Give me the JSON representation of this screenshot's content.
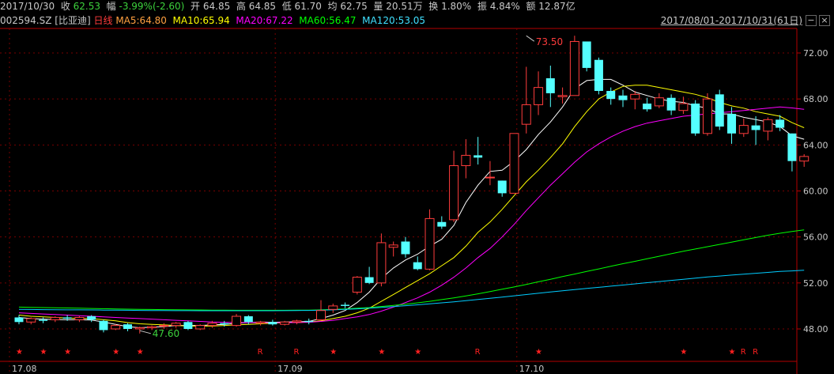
{
  "header": {
    "date": "2017/10/30",
    "close_label": "收",
    "close": "62.53",
    "change_label": "幅",
    "change": "-3.99%(-2.60)",
    "open_label": "开",
    "open": "64.85",
    "high_label": "高",
    "high": "64.85",
    "low_label": "低",
    "low": "61.70",
    "avg_label": "均",
    "avg": "62.75",
    "vol_label": "量",
    "vol": "20.51万",
    "turn_label": "换",
    "turn": "1.80%",
    "amp_label": "振",
    "amp": "4.84%",
    "amt_label": "额",
    "amt": "12.87亿"
  },
  "legend": {
    "code": "002594.SZ [比亚迪]",
    "period": "日线",
    "ma5": "MA5:64.80",
    "ma10": "MA10:65.94",
    "ma20": "MA20:67.22",
    "ma60": "MA60:56.47",
    "ma120": "MA120:53.05",
    "range": "2017/08/01-2017/10/31(61日)"
  },
  "controls": {
    "min": "−",
    "close": "×"
  },
  "colors": {
    "up": "#ff3c3c",
    "down": "#54ffff",
    "ma5": "#ffffff",
    "ma10": "#ffff00",
    "ma20": "#ff00ff",
    "ma60": "#00ff00",
    "ma120": "#00ccff",
    "axis": "#b40000",
    "grid": "#780000"
  },
  "chart_data": {
    "type": "candlestick",
    "ylim": [
      47,
      74
    ],
    "yticks": [
      "72.00",
      "68.00",
      "64.00",
      "60.00",
      "56.00",
      "52.00",
      "48.00"
    ],
    "x_labels": [
      {
        "index": 0,
        "label": "17.08"
      },
      {
        "index": 22,
        "label": "17.09"
      },
      {
        "index": 42,
        "label": "17.10"
      }
    ],
    "annotations": [
      {
        "index": 42,
        "value": 73.5,
        "label": "73.50"
      },
      {
        "index": 10,
        "value": 47.6,
        "label": "47.60"
      }
    ],
    "candles": [
      [
        49.0,
        48.6,
        49.2,
        48.4
      ],
      [
        48.6,
        48.9,
        49.0,
        48.4
      ],
      [
        48.8,
        48.7,
        49.0,
        48.5
      ],
      [
        48.8,
        49.0,
        49.1,
        48.6
      ],
      [
        49.0,
        48.9,
        49.2,
        48.7
      ],
      [
        48.8,
        49.0,
        49.1,
        48.6
      ],
      [
        49.1,
        48.8,
        49.2,
        48.6
      ],
      [
        48.7,
        47.9,
        48.8,
        47.7
      ],
      [
        48.0,
        48.3,
        48.4,
        47.9
      ],
      [
        48.4,
        48.0,
        48.5,
        47.8
      ],
      [
        48.0,
        48.1,
        48.2,
        47.6
      ],
      [
        48.1,
        48.2,
        48.3,
        47.9
      ],
      [
        48.3,
        48.3,
        48.5,
        48.0
      ],
      [
        48.3,
        48.5,
        48.6,
        48.1
      ],
      [
        48.6,
        48.0,
        48.7,
        47.9
      ],
      [
        48.0,
        48.3,
        48.4,
        47.9
      ],
      [
        48.3,
        48.5,
        48.7,
        48.1
      ],
      [
        48.5,
        48.4,
        48.7,
        48.2
      ],
      [
        48.3,
        49.1,
        49.3,
        48.2
      ],
      [
        49.1,
        48.6,
        49.2,
        48.4
      ],
      [
        48.5,
        48.6,
        48.7,
        48.3
      ],
      [
        48.6,
        48.4,
        48.8,
        48.3
      ],
      [
        48.4,
        48.6,
        48.7,
        48.3
      ],
      [
        48.6,
        48.7,
        48.8,
        48.4
      ],
      [
        48.7,
        48.6,
        48.9,
        48.4
      ],
      [
        48.8,
        49.6,
        50.5,
        48.7
      ],
      [
        49.7,
        50.0,
        50.2,
        49.4
      ],
      [
        50.1,
        50.0,
        50.3,
        49.8
      ],
      [
        51.2,
        52.5,
        52.6,
        51.0
      ],
      [
        52.5,
        52.0,
        53.4,
        51.9
      ],
      [
        52.0,
        55.5,
        56.3,
        51.7
      ],
      [
        55.1,
        55.3,
        55.6,
        54.3
      ],
      [
        55.6,
        54.5,
        56.0,
        54.2
      ],
      [
        53.8,
        53.2,
        54.3,
        53.1
      ],
      [
        53.2,
        57.6,
        58.4,
        53.1
      ],
      [
        57.3,
        56.9,
        57.8,
        56.7
      ],
      [
        57.5,
        62.2,
        63.5,
        57.3
      ],
      [
        62.2,
        63.1,
        64.5,
        61.1
      ],
      [
        63.1,
        62.9,
        64.7,
        62.3
      ],
      [
        61.2,
        61.2,
        62.6,
        60.5
      ],
      [
        60.9,
        59.8,
        60.9,
        59.5
      ],
      [
        59.8,
        65.0,
        65.0,
        59.8
      ],
      [
        65.8,
        67.5,
        70.8,
        65.0
      ],
      [
        67.5,
        69.0,
        70.4,
        66.6
      ],
      [
        69.8,
        68.5,
        70.9,
        67.3
      ],
      [
        68.2,
        68.3,
        69.0,
        67.6
      ],
      [
        68.3,
        73.0,
        73.5,
        71.2
      ],
      [
        73.0,
        70.7,
        71.4,
        70.4
      ],
      [
        71.4,
        68.7,
        71.6,
        68.4
      ],
      [
        68.7,
        68.0,
        69.0,
        67.5
      ],
      [
        68.3,
        67.9,
        68.8,
        67.3
      ],
      [
        68.0,
        68.4,
        68.7,
        67.1
      ],
      [
        67.6,
        67.1,
        68.1,
        66.9
      ],
      [
        67.4,
        68.1,
        68.5,
        67.2
      ],
      [
        68.1,
        67.0,
        68.4,
        66.6
      ],
      [
        67.0,
        67.6,
        68.2,
        66.7
      ],
      [
        67.6,
        65.0,
        67.9,
        64.8
      ],
      [
        65.0,
        68.0,
        68.5,
        64.8
      ],
      [
        68.4,
        65.6,
        68.8,
        65.3
      ],
      [
        66.7,
        65.0,
        67.3,
        64.1
      ],
      [
        65.0,
        65.7,
        66.3,
        64.7
      ],
      [
        65.7,
        65.3,
        66.5,
        64.0
      ],
      [
        65.2,
        66.2,
        66.4,
        64.4
      ],
      [
        66.2,
        65.5,
        66.6,
        65.2
      ],
      [
        65.0,
        62.6,
        65.0,
        61.7
      ],
      [
        62.6,
        63.0,
        63.2,
        62.1
      ]
    ],
    "series": [
      {
        "name": "MA5",
        "values": [
          49.0,
          48.9,
          48.85,
          48.82,
          48.8,
          48.8,
          48.78,
          48.6,
          48.4,
          48.2,
          48.1,
          48.15,
          48.2,
          48.3,
          48.3,
          48.3,
          48.35,
          48.4,
          48.5,
          48.55,
          48.6,
          48.58,
          48.6,
          48.62,
          48.65,
          48.9,
          49.2,
          49.6,
          50.3,
          51.2,
          52.4,
          53.3,
          54.0,
          54.5,
          55.2,
          55.8,
          57.0,
          59.0,
          60.5,
          61.7,
          61.8,
          62.6,
          63.6,
          64.9,
          66.0,
          67.3,
          68.9,
          69.6,
          69.7,
          69.7,
          69.2,
          68.6,
          68.3,
          68.0,
          67.8,
          67.7,
          67.4,
          67.2,
          66.7,
          66.7,
          66.4,
          66.2,
          66.0,
          65.6,
          64.8,
          64.5
        ]
      },
      {
        "name": "MA10",
        "values": [
          49.2,
          49.1,
          49.05,
          49.0,
          48.95,
          48.92,
          48.9,
          48.8,
          48.7,
          48.55,
          48.45,
          48.4,
          48.35,
          48.3,
          48.25,
          48.25,
          48.25,
          48.3,
          48.35,
          48.4,
          48.45,
          48.5,
          48.55,
          48.55,
          48.6,
          48.7,
          48.9,
          49.1,
          49.4,
          49.8,
          50.4,
          51.0,
          51.6,
          52.2,
          52.8,
          53.5,
          54.2,
          55.2,
          56.4,
          57.3,
          58.4,
          59.6,
          60.8,
          61.8,
          62.9,
          64.1,
          65.6,
          66.9,
          68.0,
          68.6,
          69.1,
          69.2,
          69.2,
          69.0,
          68.8,
          68.6,
          68.4,
          68.1,
          67.7,
          67.4,
          67.2,
          66.9,
          66.7,
          66.5,
          65.94,
          65.5
        ]
      },
      {
        "name": "MA20",
        "values": [
          49.4,
          49.35,
          49.3,
          49.25,
          49.2,
          49.15,
          49.1,
          49.05,
          49.0,
          48.95,
          48.9,
          48.85,
          48.8,
          48.75,
          48.7,
          48.65,
          48.6,
          48.58,
          48.56,
          48.55,
          48.55,
          48.55,
          48.55,
          48.56,
          48.58,
          48.65,
          48.75,
          48.9,
          49.05,
          49.25,
          49.55,
          49.9,
          50.3,
          50.7,
          51.2,
          51.8,
          52.5,
          53.3,
          54.2,
          55.0,
          56.0,
          57.1,
          58.3,
          59.4,
          60.5,
          61.5,
          62.5,
          63.4,
          64.1,
          64.7,
          65.2,
          65.6,
          65.9,
          66.1,
          66.3,
          66.5,
          66.6,
          66.7,
          66.8,
          66.9,
          67.0,
          67.1,
          67.2,
          67.3,
          67.22,
          67.1
        ]
      },
      {
        "name": "MA60",
        "values": [
          49.9,
          49.88,
          49.86,
          49.84,
          49.82,
          49.8,
          49.78,
          49.76,
          49.74,
          49.72,
          49.7,
          49.69,
          49.68,
          49.67,
          49.66,
          49.65,
          49.64,
          49.63,
          49.62,
          49.62,
          49.62,
          49.62,
          49.62,
          49.63,
          49.64,
          49.66,
          49.7,
          49.74,
          49.8,
          49.86,
          49.95,
          50.05,
          50.15,
          50.27,
          50.4,
          50.55,
          50.7,
          50.87,
          51.05,
          51.25,
          51.45,
          51.65,
          51.87,
          52.1,
          52.32,
          52.55,
          52.77,
          53.0,
          53.22,
          53.45,
          53.67,
          53.88,
          54.1,
          54.32,
          54.54,
          54.75,
          54.95,
          55.15,
          55.35,
          55.55,
          55.75,
          55.95,
          56.15,
          56.32,
          56.47,
          56.62
        ]
      },
      {
        "name": "MA120",
        "values": [
          49.7,
          49.69,
          49.68,
          49.67,
          49.66,
          49.66,
          49.65,
          49.64,
          49.63,
          49.62,
          49.61,
          49.6,
          49.6,
          49.59,
          49.59,
          49.58,
          49.58,
          49.58,
          49.58,
          49.58,
          49.58,
          49.58,
          49.59,
          49.6,
          49.61,
          49.63,
          49.66,
          49.7,
          49.75,
          49.8,
          49.87,
          49.94,
          50.02,
          50.1,
          50.18,
          50.27,
          50.36,
          50.46,
          50.56,
          50.66,
          50.77,
          50.88,
          50.99,
          51.1,
          51.21,
          51.32,
          51.42,
          51.52,
          51.62,
          51.72,
          51.82,
          51.92,
          52.02,
          52.12,
          52.22,
          52.32,
          52.42,
          52.52,
          52.6,
          52.68,
          52.76,
          52.84,
          52.92,
          53.0,
          53.05,
          53.1
        ]
      }
    ],
    "markers": [
      {
        "index": 0,
        "label": "★"
      },
      {
        "index": 2,
        "label": "★"
      },
      {
        "index": 4,
        "label": "★"
      },
      {
        "index": 8,
        "label": "★"
      },
      {
        "index": 10,
        "label": "★"
      },
      {
        "index": 20,
        "label": "R"
      },
      {
        "index": 23,
        "label": "R"
      },
      {
        "index": 26,
        "label": "★"
      },
      {
        "index": 30,
        "label": "★"
      },
      {
        "index": 33,
        "label": "★"
      },
      {
        "index": 38,
        "label": "R"
      },
      {
        "index": 43,
        "label": "★"
      },
      {
        "index": 55,
        "label": "★"
      },
      {
        "index": 59,
        "label": "★"
      },
      {
        "index": 60,
        "label": "R"
      },
      {
        "index": 61,
        "label": "R"
      }
    ]
  }
}
